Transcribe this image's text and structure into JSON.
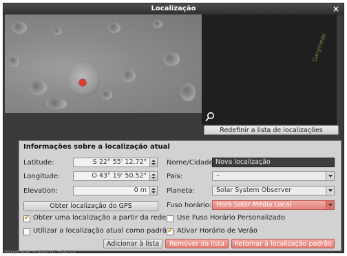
{
  "window": {
    "title": "Localização",
    "close_symbol": "×"
  },
  "map": {
    "location_marker_color": "#e23a2f"
  },
  "planet_preview": {
    "label": "Ganymede"
  },
  "buttons": {
    "reset_list": "Redefinir a lista de localizações",
    "get_gps": "Obter localização do GPS",
    "add_to_list": "Adicionar à lista",
    "remove_from_list": "Remover da lista",
    "return_default": "Retornar à localização padrão"
  },
  "panel": {
    "title": "Informações sobre a localização atual",
    "latitude": {
      "label": "Latitude:",
      "value": "S 22° 55' 12.72\""
    },
    "longitude": {
      "label": "Longitude:",
      "value": "O 43° 19' 50.52\""
    },
    "elevation": {
      "label": "Elevation:",
      "value": "0 m"
    },
    "name_city": {
      "label": "Nome/Cidade:",
      "value": "Nova localização"
    },
    "country": {
      "label": "País:",
      "value": "–"
    },
    "planet": {
      "label": "Planeta:",
      "value": "Solar System Observer"
    },
    "timezone": {
      "label": "Fuso horário:",
      "value": "Hora Solar Média Local"
    },
    "checks": {
      "network_location": {
        "label": "Obter uma localização a partir da rede",
        "checked": true
      },
      "use_as_default": {
        "label": "Utilizar a localização atual como padrão",
        "checked": false
      },
      "custom_timezone": {
        "label": "Use Fuso Horário Personalizado",
        "checked": false
      },
      "daylight_saving": {
        "label": "Ativar Horário de Verão",
        "checked": true
      }
    }
  },
  "status_text": "Ganymede +0000 UT +00:00",
  "colors": {
    "accent_red": "#e2857c",
    "check_color": "#c08400"
  }
}
